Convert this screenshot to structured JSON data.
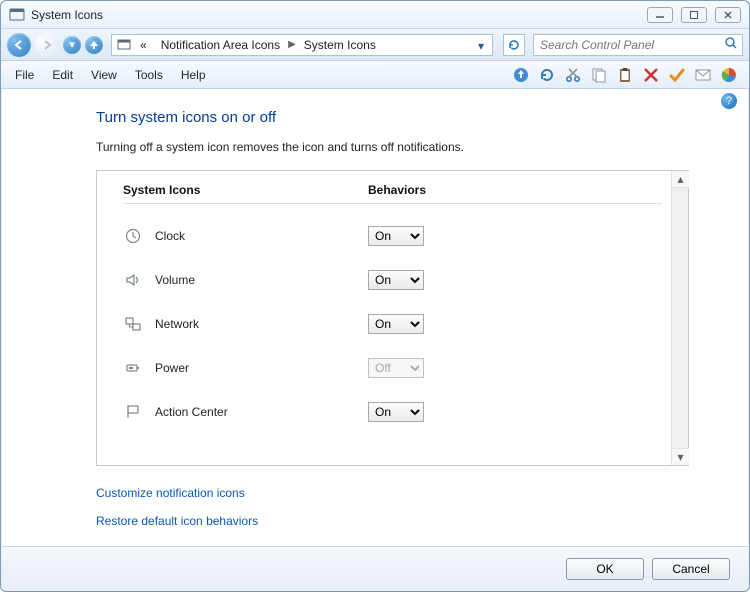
{
  "window": {
    "title": "System Icons"
  },
  "nav": {
    "breadcrumb_prefix": "«",
    "crumbs": [
      "Notification Area Icons",
      "System Icons"
    ]
  },
  "search": {
    "placeholder": "Search Control Panel"
  },
  "menubar": {
    "items": [
      "File",
      "Edit",
      "View",
      "Tools",
      "Help"
    ]
  },
  "page": {
    "title": "Turn system icons on or off",
    "description": "Turning off a system icon removes the icon and turns off notifications."
  },
  "table": {
    "col1": "System Icons",
    "col2": "Behaviors",
    "options": [
      "On",
      "Off"
    ],
    "rows": [
      {
        "icon": "clock-icon",
        "label": "Clock",
        "value": "On",
        "enabled": true
      },
      {
        "icon": "volume-icon",
        "label": "Volume",
        "value": "On",
        "enabled": true
      },
      {
        "icon": "network-icon",
        "label": "Network",
        "value": "On",
        "enabled": true
      },
      {
        "icon": "power-icon",
        "label": "Power",
        "value": "Off",
        "enabled": false
      },
      {
        "icon": "action-center-icon",
        "label": "Action Center",
        "value": "On",
        "enabled": true
      }
    ]
  },
  "links": {
    "customize": "Customize notification icons",
    "restore": "Restore default icon behaviors"
  },
  "buttons": {
    "ok": "OK",
    "cancel": "Cancel"
  }
}
